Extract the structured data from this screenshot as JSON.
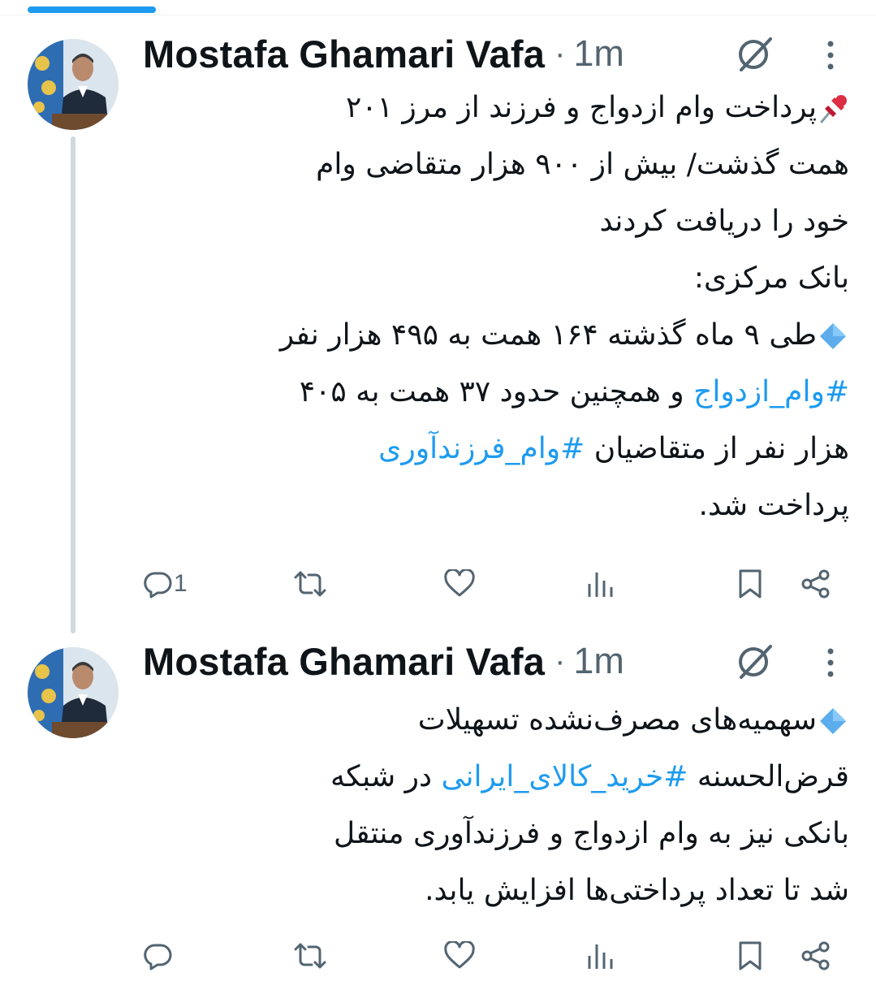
{
  "tweets": [
    {
      "author_name": "Mostafa Ghamari Vafa",
      "separator": "·",
      "time": "1m",
      "reply_count": "1",
      "lines": [
        "پرداخت وام ازدواج و فرزند از مرز ۲۰۱",
        "همت گذشت/ بیش از ۹۰۰ هزار متقاضی وام",
        "خود را دریافت کردند",
        "بانک مرکزی:",
        "طی ۹ ماه گذشته ۱۶۴ همت به ۴۹۵ هزار نفر",
        "و همچنین حدود ۳۷ همت به ۴۰۵",
        "#وام_ازدواج",
        "هزار نفر از متقاضیان",
        "#وام_فرزندآوری",
        "پرداخت شد."
      ]
    },
    {
      "author_name": "Mostafa Ghamari Vafa",
      "separator": "·",
      "time": "1m",
      "reply_count": "",
      "lines": [
        "سهمیه‌های مصرف‌نشده تسهیلات",
        "قرض‌الحسنه",
        "#خرید_کالای_ایرانی",
        "در شبکه",
        "بانکی نیز به وام ازدواج و فرزندآوری منتقل",
        "شد تا تعداد پرداختی‌ها افزایش یابد."
      ]
    }
  ],
  "colors": {
    "accent": "#1d9bf0",
    "text": "#0f1419",
    "muted": "#536471",
    "thread_line": "#cfd9de"
  },
  "icons": [
    "pushpin-emoji",
    "blue-diamond-emoji",
    "reply-icon",
    "retweet-icon",
    "like-icon",
    "views-icon",
    "bookmark-icon",
    "share-icon",
    "grok-icon",
    "more-icon"
  ]
}
